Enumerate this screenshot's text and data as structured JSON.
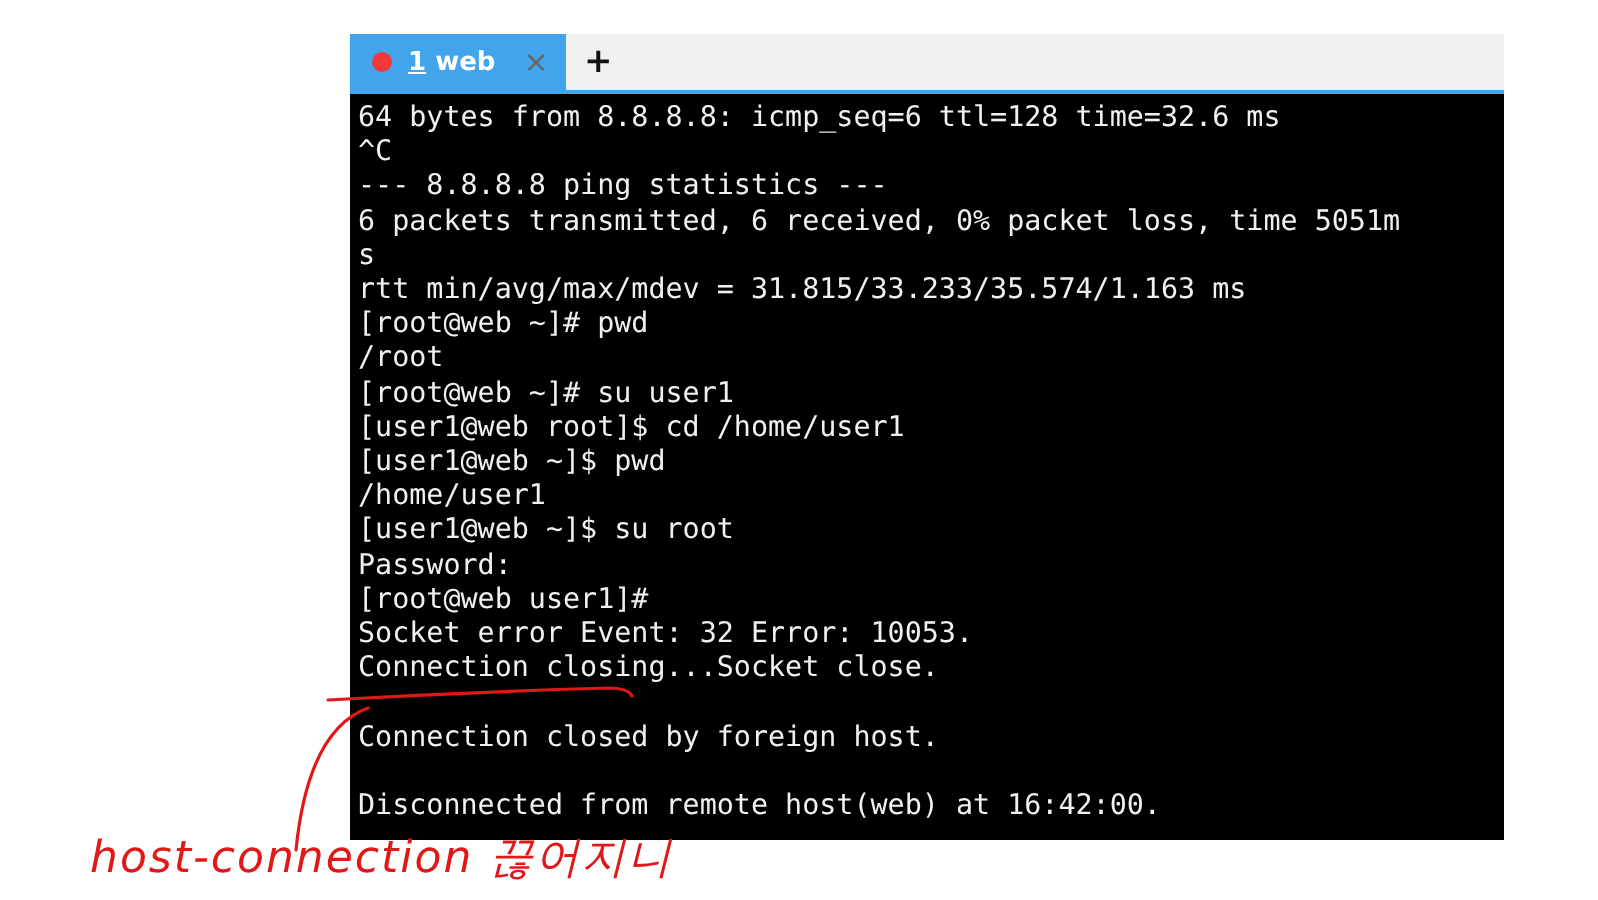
{
  "tabs": [
    {
      "index": "1",
      "label": "web",
      "close": "×",
      "selected": true
    }
  ],
  "new_tab": "+",
  "terminal": {
    "lines": [
      {
        "kind": "text",
        "text": "64 bytes from 8.8.8.8: icmp_seq=6 ttl=128 time=32.6 ms"
      },
      {
        "kind": "text",
        "text": "^C"
      },
      {
        "kind": "text",
        "text": "--- 8.8.8.8 ping statistics ---"
      },
      {
        "kind": "text",
        "text": "6 packets transmitted, 6 received, 0% packet loss, time 5051m"
      },
      {
        "kind": "text",
        "text": "s"
      },
      {
        "kind": "text",
        "text": "rtt min/avg/max/mdev = 31.815/33.233/35.574/1.163 ms"
      },
      {
        "kind": "text",
        "text": "[root@web ~]# pwd"
      },
      {
        "kind": "text",
        "text": "/root"
      },
      {
        "kind": "text",
        "text": "[root@web ~]# su user1"
      },
      {
        "kind": "text",
        "text": "[user1@web root]$ cd /home/user1"
      },
      {
        "kind": "text",
        "text": "[user1@web ~]$ pwd"
      },
      {
        "kind": "text",
        "text": "/home/user1"
      },
      {
        "kind": "text",
        "text": "[user1@web ~]$ su root"
      },
      {
        "kind": "text",
        "text": "Password:"
      },
      {
        "kind": "text",
        "text": "[root@web user1]#"
      },
      {
        "kind": "text",
        "text": "Socket error Event: 32 Error: 10053."
      },
      {
        "kind": "text",
        "text": "Connection closing...Socket close."
      },
      {
        "kind": "blank"
      },
      {
        "kind": "text",
        "text": "Connection closed by foreign host."
      },
      {
        "kind": "blank"
      },
      {
        "kind": "text",
        "text": "Disconnected from remote host(web) at 16:42:00."
      }
    ]
  },
  "annotation": {
    "text": "host-connection 끊어지니"
  }
}
